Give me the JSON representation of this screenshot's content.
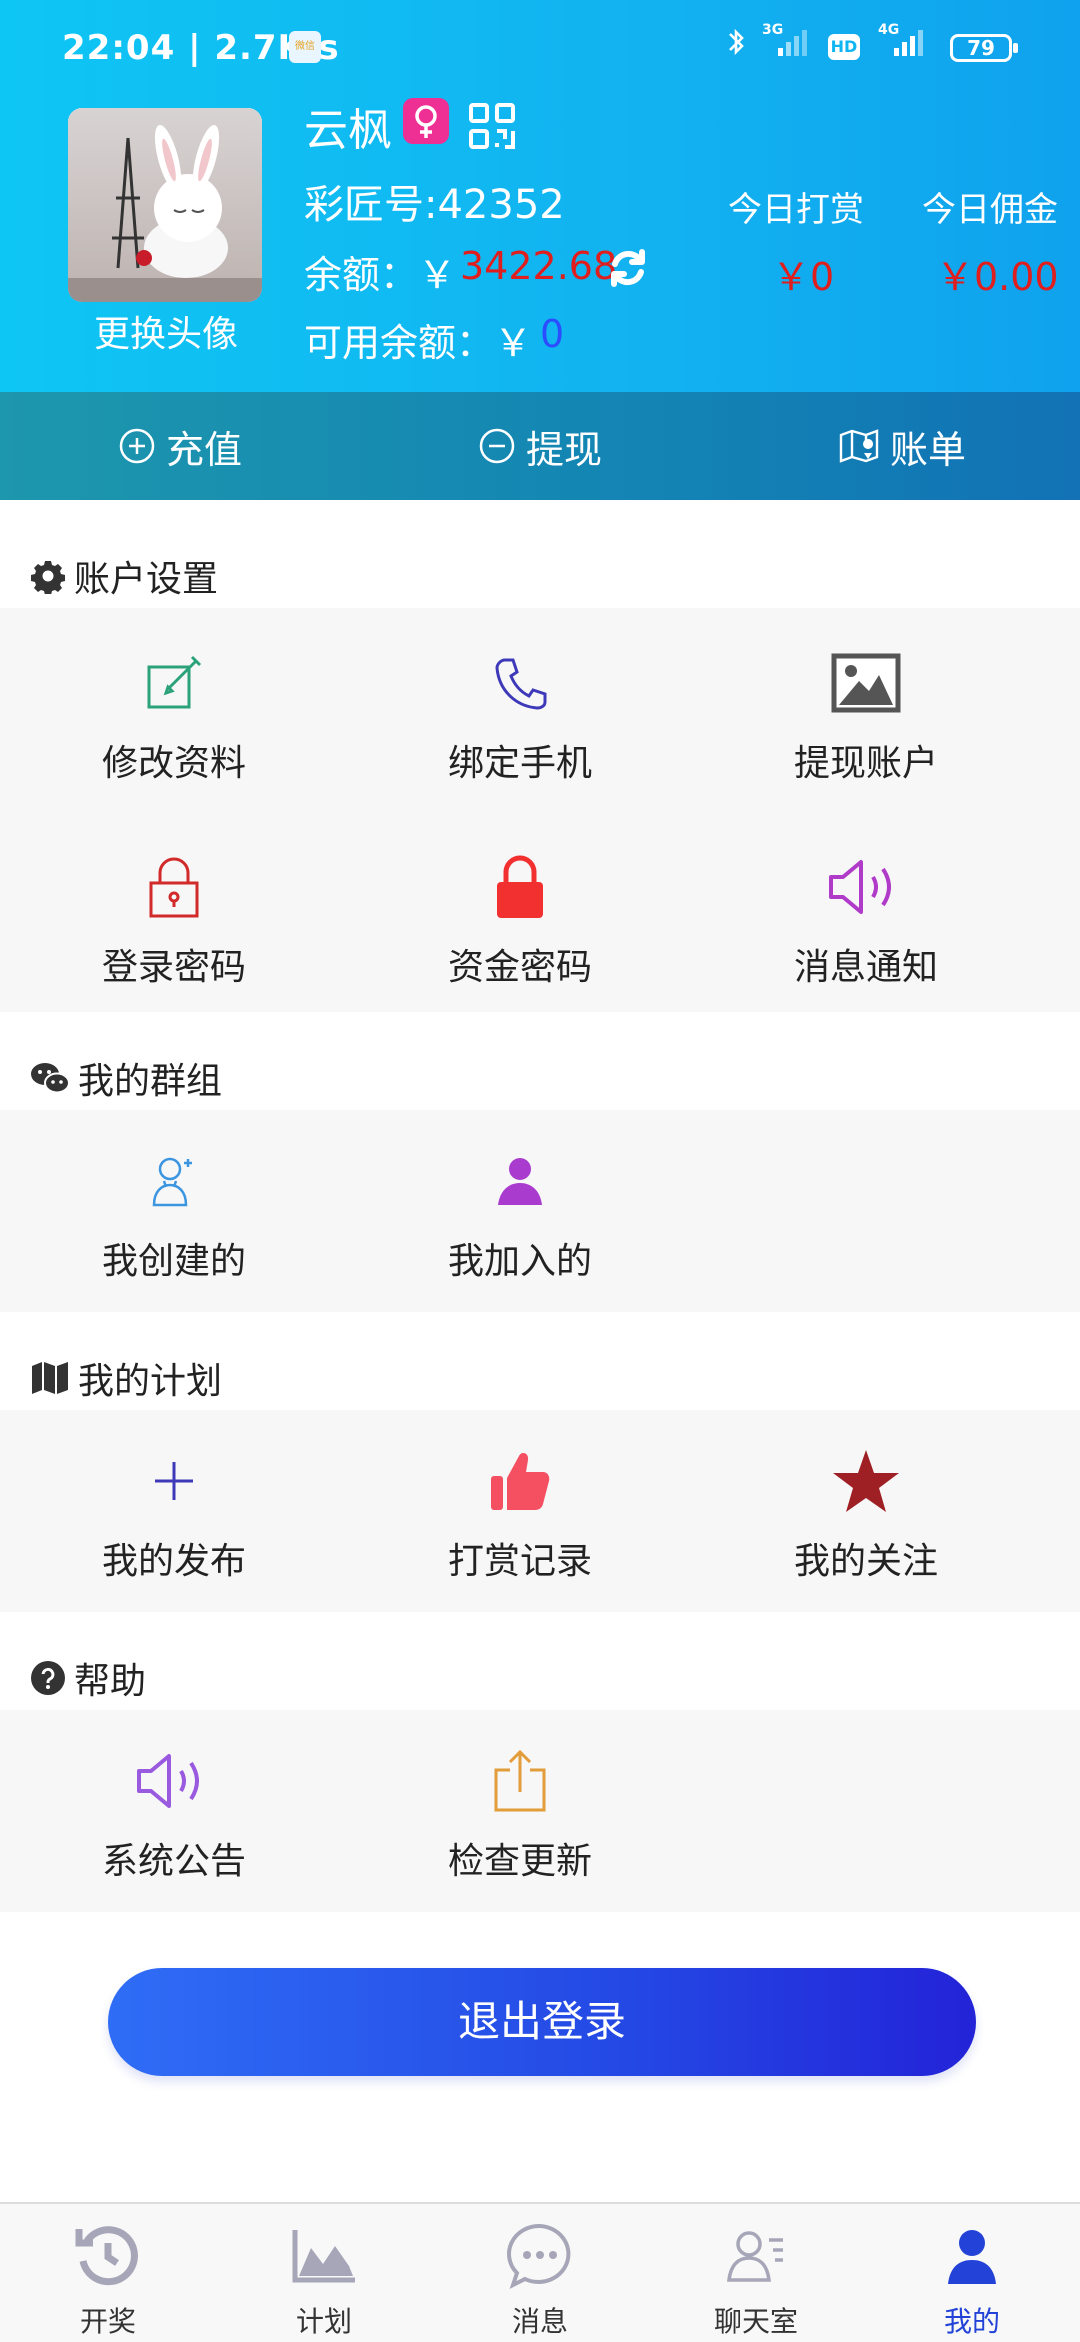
{
  "status_bar": {
    "time_speed": "22:04 | 2.7K/s",
    "badge": "微信",
    "net1": "3G",
    "hd": "HD",
    "net2": "4G",
    "battery": "79"
  },
  "profile": {
    "change_avatar": "更换头像",
    "username": "云枫",
    "uid": "彩匠号:42352",
    "balance_label": "余额：￥",
    "balance_value": "3422.68",
    "available_label": "可用余额：￥",
    "available_value": "0",
    "today_reward_label": "今日打赏",
    "today_reward_value": "￥0",
    "today_commission_label": "今日佣金",
    "today_commission_value": "￥0.00"
  },
  "actions": {
    "recharge": "充值",
    "withdraw": "提现",
    "bill": "账单"
  },
  "sections": {
    "account": {
      "title": "账户设置",
      "items": [
        "修改资料",
        "绑定手机",
        "提现账户",
        "登录密码",
        "资金密码",
        "消息通知"
      ]
    },
    "groups": {
      "title": "我的群组",
      "items": [
        "我创建的",
        "我加入的"
      ]
    },
    "plans": {
      "title": "我的计划",
      "items": [
        "我的发布",
        "打赏记录",
        "我的关注"
      ]
    },
    "help": {
      "title": "帮助",
      "items": [
        "系统公告",
        "检查更新"
      ]
    }
  },
  "logout": "退出登录",
  "bottom_nav": {
    "items": [
      "开奖",
      "计划",
      "消息",
      "聊天室",
      "我的"
    ],
    "active": "我的"
  },
  "colors": {
    "header": "#12b2f0",
    "actionbar": "#1384b4",
    "accent": "#2343d8",
    "money": "#e01e1e"
  }
}
